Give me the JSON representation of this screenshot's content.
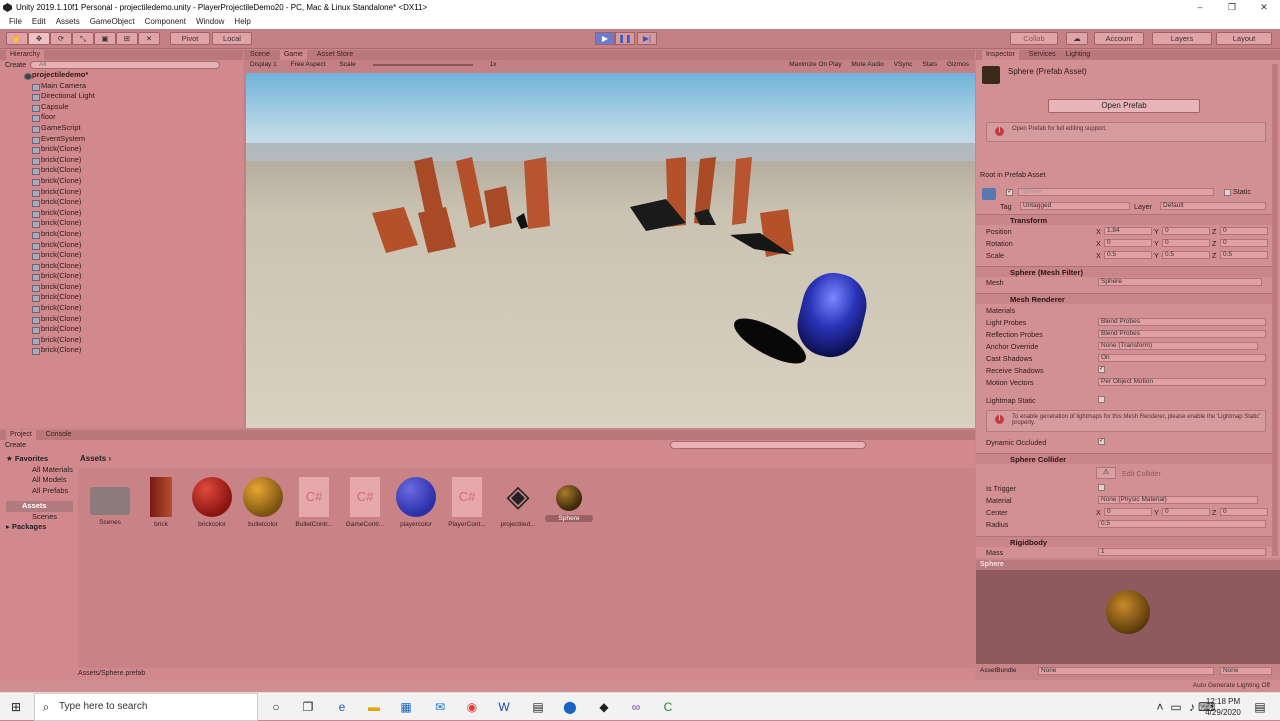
{
  "window": {
    "title": "Unity 2019.1.10f1 Personal - projectiledemo.unity - PlayerProjectileDemo20 - PC, Mac & Linux Standalone* <DX11>",
    "minimize": "–",
    "maximize": "❐",
    "close": "✕"
  },
  "menu": [
    "File",
    "Edit",
    "Assets",
    "GameObject",
    "Component",
    "Window",
    "Help"
  ],
  "toolbar": {
    "pivot": "Pivot",
    "local": "Local",
    "collab": "Collab",
    "account": "Account",
    "layers": "Layers",
    "layout": "Layout",
    "play": "▶",
    "pause": "❚❚",
    "step": "▶|"
  },
  "hierarchy": {
    "tab": "Hierarchy",
    "create": "Create",
    "search": "All",
    "scene": "projectiledemo*",
    "items": [
      "Main Camera",
      "Directional Light",
      "Capsule",
      "floor",
      "GameScript",
      "EventSystem",
      "brick(Clone)",
      "brick(Clone)",
      "brick(Clone)",
      "brick(Clone)",
      "brick(Clone)",
      "brick(Clone)",
      "brick(Clone)",
      "brick(Clone)",
      "brick(Clone)",
      "brick(Clone)",
      "brick(Clone)",
      "brick(Clone)",
      "brick(Clone)",
      "brick(Clone)",
      "brick(Clone)",
      "brick(Clone)",
      "brick(Clone)",
      "brick(Clone)",
      "brick(Clone)",
      "brick(Clone)"
    ]
  },
  "view": {
    "tabs": [
      "Scene",
      "Game",
      "Asset Store"
    ],
    "display": "Display 1",
    "aspect": "Free Aspect",
    "scale_label": "Scale",
    "scale_value": "1x",
    "options": [
      "Maximize On Play",
      "Mute Audio",
      "VSync",
      "Stats",
      "Gizmos"
    ]
  },
  "inspector": {
    "tabs": [
      "Inspector",
      "Services",
      "Lighting"
    ],
    "object": "Sphere (Prefab Asset)",
    "open_prefab": "Open Prefab",
    "open_info": "Open Prefab for full editing support.",
    "root_label": "Root in Prefab Asset",
    "name_field": "Sphere",
    "static": "Static",
    "tag_label": "Tag",
    "tag": "Untagged",
    "layer_label": "Layer",
    "layer": "Default",
    "transform": {
      "title": "Transform",
      "position_label": "Position",
      "rotation_label": "Rotation",
      "scale_label": "Scale",
      "position": [
        "1.84",
        "0",
        "0"
      ],
      "rotation": [
        "0",
        "0",
        "0"
      ],
      "scale": [
        "0.5",
        "0.5",
        "0.5"
      ]
    },
    "axes": [
      "X",
      "Y",
      "Z"
    ],
    "meshfilter": {
      "title": "Sphere (Mesh Filter)",
      "mesh_label": "Mesh",
      "mesh": "Sphere"
    },
    "renderer": {
      "title": "Mesh Renderer",
      "materials": "Materials",
      "light_probes_label": "Light Probes",
      "light_probes": "Blend Probes",
      "reflection_label": "Reflection Probes",
      "reflection": "Blend Probes",
      "anchor_label": "Anchor Override",
      "anchor": "None (Transform)",
      "cast_label": "Cast Shadows",
      "cast": "On",
      "receive_label": "Receive Shadows",
      "motion_label": "Motion Vectors",
      "motion": "Per Object Motion",
      "lightmap_label": "Lightmap Static",
      "lightmap_info": "To enable generation of lightmaps for this Mesh Renderer, please enable the 'Lightmap Static' property.",
      "dynamic_label": "Dynamic Occluded"
    },
    "collider": {
      "title": "Sphere Collider",
      "edit": "Edit Collider",
      "trigger_label": "Is Trigger",
      "material_label": "Material",
      "material": "None (Physic Material)",
      "center_label": "Center",
      "center": [
        "0",
        "0",
        "0"
      ],
      "radius_label": "Radius",
      "radius": "0.5"
    },
    "rigidbody": {
      "title": "Rigidbody",
      "mass_label": "Mass",
      "mass": "1"
    }
  },
  "preview": {
    "title": "Sphere",
    "assetbundle_label": "AssetBundle",
    "assetbundle": "None",
    "variant": "None"
  },
  "project": {
    "tabs": [
      "Project",
      "Console"
    ],
    "create": "Create",
    "favorites": "Favorites",
    "fav_items": [
      "All Materials",
      "All Models",
      "All Prefabs"
    ],
    "assets": "Assets",
    "asset_folders": [
      "Scenes"
    ],
    "packages": "Packages",
    "breadcrumb": "Assets",
    "items": [
      {
        "label": "Scenes",
        "kind": "folder"
      },
      {
        "label": "brick",
        "kind": "brick"
      },
      {
        "label": "brickcolor",
        "kind": "red"
      },
      {
        "label": "bulletcolor",
        "kind": "gold"
      },
      {
        "label": "BulletContr...",
        "kind": "cs"
      },
      {
        "label": "GameContr...",
        "kind": "cs"
      },
      {
        "label": "playercolor",
        "kind": "blue"
      },
      {
        "label": "PlayerCont...",
        "kind": "cs"
      },
      {
        "label": "projectiled...",
        "kind": "unity"
      },
      {
        "label": "Sphere",
        "kind": "sphere"
      }
    ],
    "cs_glyph": "C#",
    "path": "Assets/Sphere.prefab"
  },
  "status": {
    "text": "Auto Generate Lighting Off"
  },
  "taskbar": {
    "search": "Type here to search",
    "time": "12:18 PM",
    "date": "4/29/2020"
  },
  "colors": {
    "brick": "#b4512b",
    "player": "#2a2fa8",
    "bullet": "#7a5312",
    "tint": "#c9868a"
  }
}
